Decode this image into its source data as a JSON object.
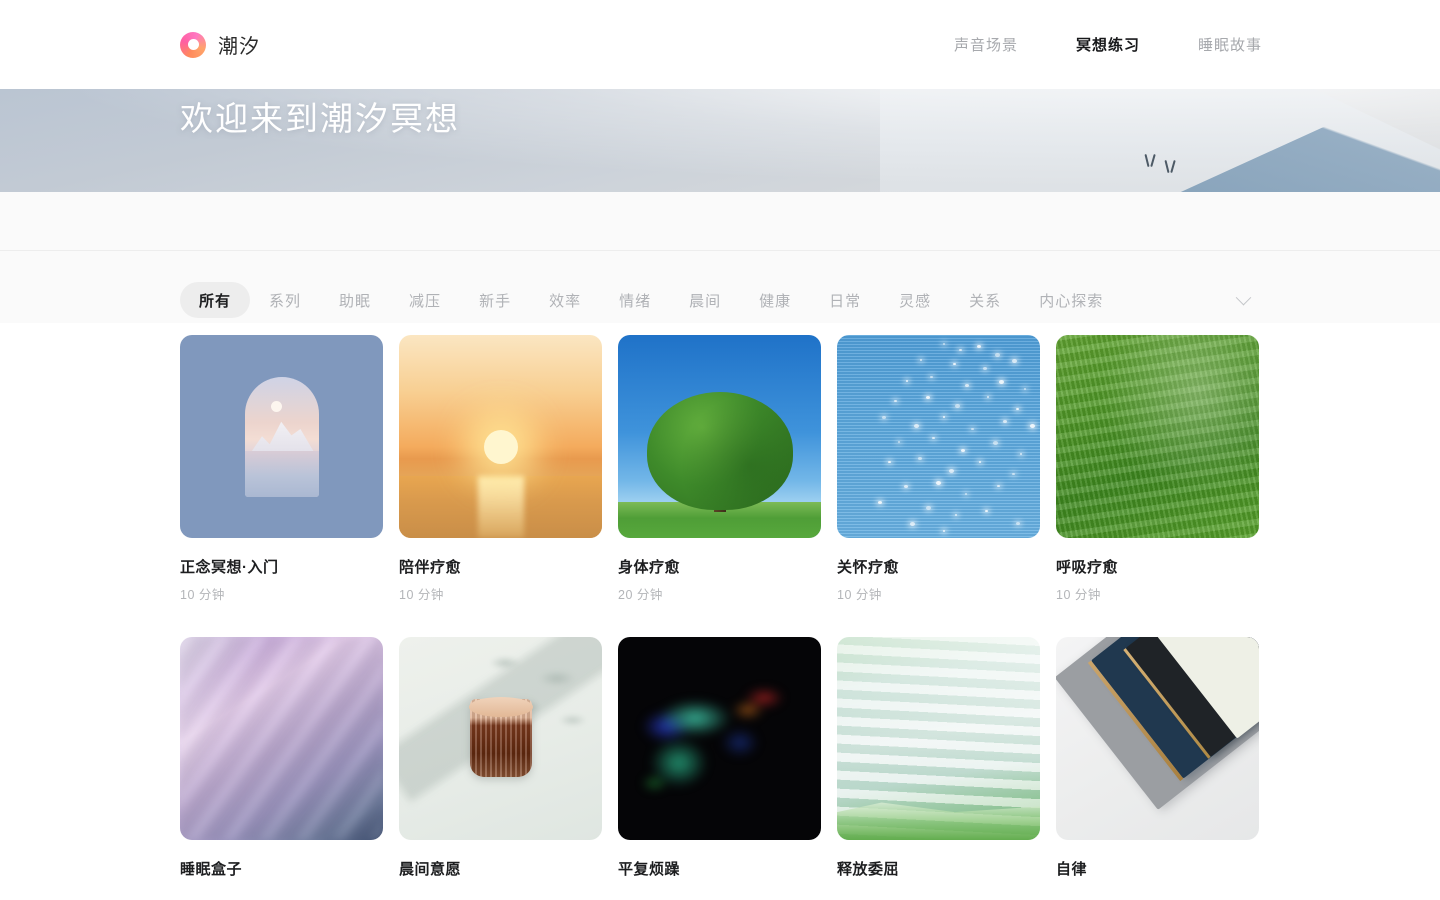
{
  "header": {
    "brand_name": "潮汐",
    "logo_icon": "tide-logo-ring-icon",
    "nav": [
      {
        "label": "声音场景",
        "active": false
      },
      {
        "label": "冥想练习",
        "active": true
      },
      {
        "label": "睡眠故事",
        "active": false
      }
    ]
  },
  "hero": {
    "title": "欢迎来到潮汐冥想"
  },
  "filters": {
    "expand_icon": "chevron-down-icon",
    "chips": [
      {
        "label": "所有",
        "active": true
      },
      {
        "label": "系列",
        "active": false
      },
      {
        "label": "助眠",
        "active": false
      },
      {
        "label": "减压",
        "active": false
      },
      {
        "label": "新手",
        "active": false
      },
      {
        "label": "效率",
        "active": false
      },
      {
        "label": "情绪",
        "active": false
      },
      {
        "label": "晨间",
        "active": false
      },
      {
        "label": "健康",
        "active": false
      },
      {
        "label": "日常",
        "active": false
      },
      {
        "label": "灵感",
        "active": false
      },
      {
        "label": "关系",
        "active": false
      },
      {
        "label": "内心探索",
        "active": false
      }
    ]
  },
  "grid": {
    "cards": [
      {
        "title": "正念冥想·入门",
        "duration": "10 分钟",
        "art": "a-arch",
        "art_name": "arch-window-mountain-thumb"
      },
      {
        "title": "陪伴疗愈",
        "duration": "10 分钟",
        "art": "a-sunset",
        "art_name": "ocean-sunset-thumb"
      },
      {
        "title": "身体疗愈",
        "duration": "20 分钟",
        "art": "a-tree",
        "art_name": "lone-tree-field-thumb"
      },
      {
        "title": "关怀疗愈",
        "duration": "10 分钟",
        "art": "a-water",
        "art_name": "sparkling-water-thumb"
      },
      {
        "title": "呼吸疗愈",
        "duration": "10 分钟",
        "art": "a-grass",
        "art_name": "green-grass-thumb"
      },
      {
        "title": "睡眠盒子",
        "duration": "",
        "art": "a-silk",
        "art_name": "purple-silk-thumb"
      },
      {
        "title": "晨间意愿",
        "duration": "",
        "art": "a-coffee",
        "art_name": "coffee-glass-shadow-thumb"
      },
      {
        "title": "平复烦躁",
        "duration": "",
        "art": "a-aurora",
        "art_name": "aurora-smoke-dark-thumb"
      },
      {
        "title": "释放委屈",
        "duration": "",
        "art": "a-marble",
        "art_name": "green-marble-paint-thumb"
      },
      {
        "title": "自律",
        "duration": "",
        "art": "a-books",
        "art_name": "stacked-notebooks-thumb"
      }
    ]
  },
  "colors": {
    "accent_pink": "#ff5fa2",
    "accent_orange": "#ff8a5c",
    "text_primary": "#1d1e20",
    "text_muted": "#b0b2b6",
    "chip_active_bg": "#ededed",
    "band_bg": "#fafafa"
  }
}
